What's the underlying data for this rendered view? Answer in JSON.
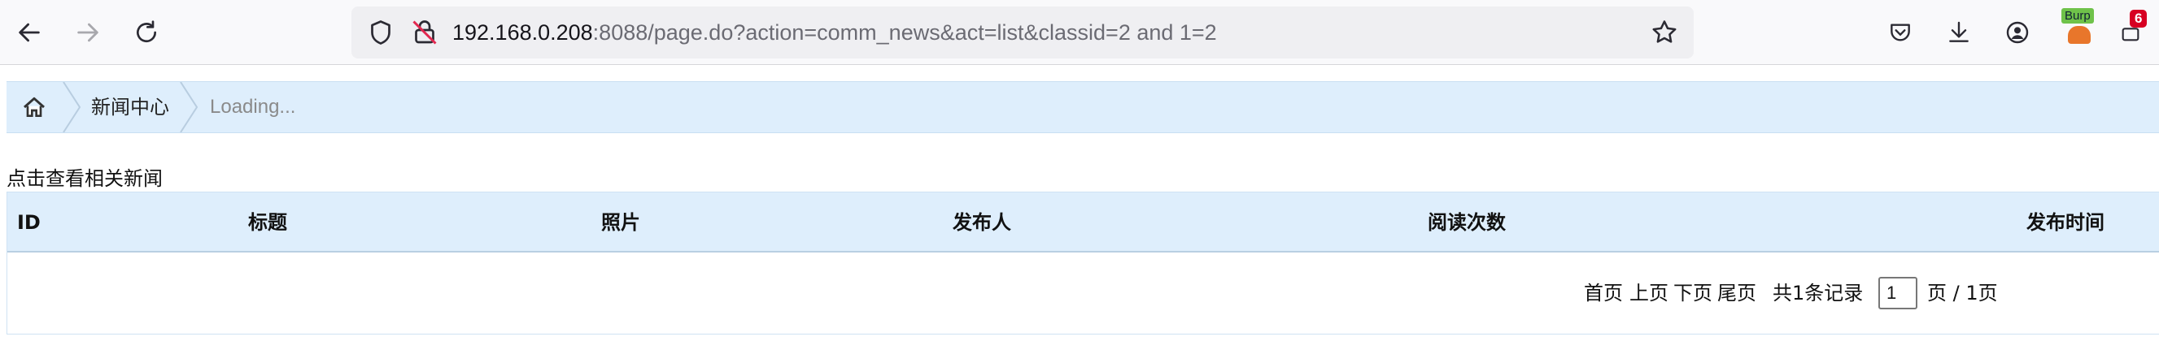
{
  "browser": {
    "url": {
      "host": "192.168.0.208",
      "rest": ":8088/page.do?action=comm_news&act=list&classid=2 and 1=2"
    },
    "extensions": {
      "burp_label": "Burp",
      "badge_count": "6"
    },
    "icons": [
      "back-icon",
      "forward-icon",
      "reload-icon",
      "shield-icon",
      "lock-icon",
      "star-icon",
      "pocket-icon",
      "download-icon",
      "account-icon",
      "burp-extension-icon",
      "extension-icon"
    ]
  },
  "breadcrumb": {
    "items": [
      "新闻中心",
      "Loading..."
    ]
  },
  "page": {
    "hint": "点击查看相关新闻",
    "table": {
      "columns": [
        "ID",
        "标题",
        "照片",
        "发布人",
        "阅读次数",
        "发布时间"
      ]
    },
    "pagination": {
      "first": "首页",
      "prev": "上页",
      "next": "下页",
      "last": "尾页",
      "total": "共1条记录",
      "current_page": "1",
      "page_of": "页 / 1页"
    }
  },
  "colors": {
    "header_bg": "#deeefc",
    "badge": "#d70022"
  }
}
